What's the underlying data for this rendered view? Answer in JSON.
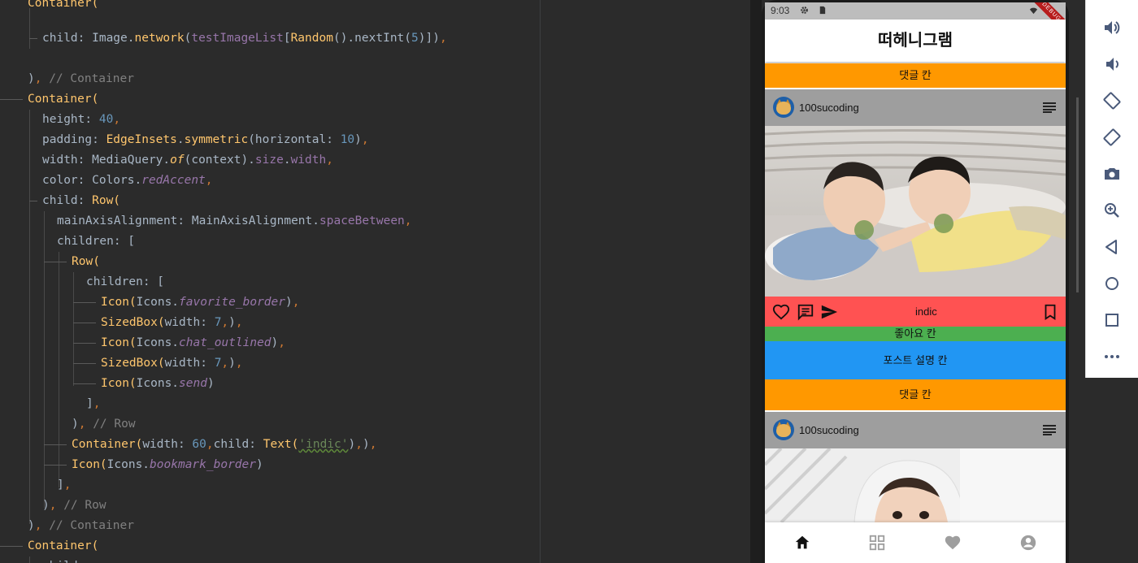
{
  "editor": {
    "lines": [
      {
        "indent": 34,
        "parts": [
          {
            "t": "Container(",
            "c": "c-cls"
          }
        ]
      },
      {
        "indent": 52,
        "parts": [
          {
            "t": "child: ",
            "c": "c-plain"
          },
          {
            "t": "Image",
            "c": "c-plain"
          },
          {
            "t": ".",
            "c": "c-plain"
          },
          {
            "t": "network",
            "c": "c-cls"
          },
          {
            "t": "(",
            "c": "c-plain"
          },
          {
            "t": "testImageList",
            "c": "c-fld"
          },
          {
            "t": "[",
            "c": "c-plain"
          },
          {
            "t": "Random",
            "c": "c-cls"
          },
          {
            "t": "().",
            "c": "c-plain"
          },
          {
            "t": "nextInt",
            "c": "c-plain"
          },
          {
            "t": "(",
            "c": "c-plain"
          },
          {
            "t": "5",
            "c": "c-num"
          },
          {
            "t": ")])",
            "c": "c-plain"
          },
          {
            "t": ",",
            "c": "c-punct"
          }
        ]
      },
      {
        "indent": 34,
        "parts": [
          {
            "t": ")",
            "c": "c-plain"
          },
          {
            "t": ", ",
            "c": "c-punct"
          },
          {
            "t": "// Container",
            "c": "c-comment"
          }
        ]
      },
      {
        "indent": 34,
        "parts": [
          {
            "t": "Container(",
            "c": "c-cls"
          }
        ]
      },
      {
        "indent": 52,
        "parts": [
          {
            "t": "height: ",
            "c": "c-plain"
          },
          {
            "t": "40",
            "c": "c-num"
          },
          {
            "t": ",",
            "c": "c-punct"
          }
        ]
      },
      {
        "indent": 52,
        "parts": [
          {
            "t": "padding: ",
            "c": "c-plain"
          },
          {
            "t": "EdgeInsets",
            "c": "c-cls"
          },
          {
            "t": ".",
            "c": "c-plain"
          },
          {
            "t": "symmetric",
            "c": "c-cls"
          },
          {
            "t": "(horizontal: ",
            "c": "c-plain"
          },
          {
            "t": "10",
            "c": "c-num"
          },
          {
            "t": ")",
            "c": "c-plain"
          },
          {
            "t": ",",
            "c": "c-punct"
          }
        ]
      },
      {
        "indent": 52,
        "parts": [
          {
            "t": "width: MediaQuery.",
            "c": "c-plain"
          },
          {
            "t": "of",
            "c": "c-method"
          },
          {
            "t": "(context).",
            "c": "c-plain"
          },
          {
            "t": "size",
            "c": "c-fld"
          },
          {
            "t": ".",
            "c": "c-plain"
          },
          {
            "t": "width",
            "c": "c-fld"
          },
          {
            "t": ",",
            "c": "c-punct"
          }
        ]
      },
      {
        "indent": 52,
        "parts": [
          {
            "t": "color: Colors.",
            "c": "c-plain"
          },
          {
            "t": "redAccent",
            "c": "c-ital"
          },
          {
            "t": ",",
            "c": "c-punct"
          }
        ]
      },
      {
        "indent": 52,
        "parts": [
          {
            "t": "child: ",
            "c": "c-plain"
          },
          {
            "t": "Row(",
            "c": "c-cls"
          }
        ]
      },
      {
        "indent": 70,
        "parts": [
          {
            "t": "mainAxisAlignment: MainAxisAlignment.",
            "c": "c-plain"
          },
          {
            "t": "spaceBetween",
            "c": "c-fld"
          },
          {
            "t": ",",
            "c": "c-punct"
          }
        ]
      },
      {
        "indent": 70,
        "parts": [
          {
            "t": "children: [",
            "c": "c-plain"
          }
        ]
      },
      {
        "indent": 88,
        "parts": [
          {
            "t": "Row(",
            "c": "c-cls"
          }
        ]
      },
      {
        "indent": 106,
        "parts": [
          {
            "t": "children: [",
            "c": "c-plain"
          }
        ]
      },
      {
        "indent": 124,
        "parts": [
          {
            "t": "Icon(",
            "c": "c-cls"
          },
          {
            "t": "Icons.",
            "c": "c-plain"
          },
          {
            "t": "favorite_border",
            "c": "c-ital"
          },
          {
            "t": ")",
            "c": "c-plain"
          },
          {
            "t": ",",
            "c": "c-punct"
          }
        ]
      },
      {
        "indent": 124,
        "parts": [
          {
            "t": "SizedBox(",
            "c": "c-cls"
          },
          {
            "t": "width: ",
            "c": "c-plain"
          },
          {
            "t": "7",
            "c": "c-num"
          },
          {
            "t": ",",
            "c": "c-punct"
          },
          {
            "t": ")",
            "c": "c-plain"
          },
          {
            "t": ",",
            "c": "c-punct"
          }
        ]
      },
      {
        "indent": 124,
        "parts": [
          {
            "t": "Icon(",
            "c": "c-cls"
          },
          {
            "t": "Icons.",
            "c": "c-plain"
          },
          {
            "t": "chat_outlined",
            "c": "c-ital"
          },
          {
            "t": ")",
            "c": "c-plain"
          },
          {
            "t": ",",
            "c": "c-punct"
          }
        ]
      },
      {
        "indent": 124,
        "parts": [
          {
            "t": "SizedBox(",
            "c": "c-cls"
          },
          {
            "t": "width: ",
            "c": "c-plain"
          },
          {
            "t": "7",
            "c": "c-num"
          },
          {
            "t": ",",
            "c": "c-punct"
          },
          {
            "t": ")",
            "c": "c-plain"
          },
          {
            "t": ",",
            "c": "c-punct"
          }
        ]
      },
      {
        "indent": 124,
        "parts": [
          {
            "t": "Icon(",
            "c": "c-cls"
          },
          {
            "t": "Icons.",
            "c": "c-plain"
          },
          {
            "t": "send",
            "c": "c-ital"
          },
          {
            "t": ")",
            "c": "c-plain"
          }
        ]
      },
      {
        "indent": 106,
        "parts": [
          {
            "t": "]",
            "c": "c-plain"
          },
          {
            "t": ",",
            "c": "c-punct"
          }
        ]
      },
      {
        "indent": 88,
        "parts": [
          {
            "t": ")",
            "c": "c-plain"
          },
          {
            "t": ", ",
            "c": "c-punct"
          },
          {
            "t": "// Row",
            "c": "c-comment"
          }
        ]
      },
      {
        "indent": 88,
        "parts": [
          {
            "t": "Container(",
            "c": "c-cls"
          },
          {
            "t": "width: ",
            "c": "c-plain"
          },
          {
            "t": "60",
            "c": "c-num"
          },
          {
            "t": ",",
            "c": "c-punct"
          },
          {
            "t": "child: ",
            "c": "c-plain"
          },
          {
            "t": "Text(",
            "c": "c-cls"
          },
          {
            "t": "'indic'",
            "c": "c-str"
          },
          {
            "t": ")",
            "c": "c-plain"
          },
          {
            "t": ",",
            "c": "c-punct"
          },
          {
            "t": ")",
            "c": "c-plain"
          },
          {
            "t": ",",
            "c": "c-punct"
          }
        ]
      },
      {
        "indent": 88,
        "parts": [
          {
            "t": "Icon(",
            "c": "c-cls"
          },
          {
            "t": "Icons.",
            "c": "c-plain"
          },
          {
            "t": "bookmark_border",
            "c": "c-ital"
          },
          {
            "t": ")",
            "c": "c-plain"
          }
        ]
      },
      {
        "indent": 70,
        "parts": [
          {
            "t": "]",
            "c": "c-plain"
          },
          {
            "t": ",",
            "c": "c-punct"
          }
        ]
      },
      {
        "indent": 52,
        "parts": [
          {
            "t": ")",
            "c": "c-plain"
          },
          {
            "t": ", ",
            "c": "c-punct"
          },
          {
            "t": "// Row",
            "c": "c-comment"
          }
        ]
      },
      {
        "indent": 34,
        "parts": [
          {
            "t": ")",
            "c": "c-plain"
          },
          {
            "t": ", ",
            "c": "c-punct"
          },
          {
            "t": "// Container",
            "c": "c-comment"
          }
        ]
      },
      {
        "indent": 34,
        "parts": [
          {
            "t": "Container(",
            "c": "c-cls"
          }
        ]
      },
      {
        "indent": 52,
        "parts": [
          {
            "t": "child: ",
            "c": "c-plain"
          }
        ]
      }
    ]
  },
  "phone": {
    "status": {
      "time": "9:03",
      "debug": "DEBUG"
    },
    "appbar_title": "떠헤니그램",
    "comment_strip": "댓글 칸",
    "like_strip": "좋아요 칸",
    "description_strip": "포스트 설명 칸",
    "posts": [
      {
        "username": "100sucoding"
      },
      {
        "username": "100sucoding"
      }
    ],
    "action_text": "indic",
    "bottom_nav": [
      "home-icon",
      "grid-icon",
      "heart-icon",
      "account-icon"
    ]
  },
  "toolbar": {
    "buttons": [
      "volume-up-icon",
      "volume-down-icon",
      "rotate-left-icon",
      "rotate-right-icon",
      "camera-icon",
      "zoom-icon",
      "back-icon",
      "home-circle-icon",
      "overview-icon",
      "more-icon"
    ]
  },
  "colors": {
    "editor_bg": "#2b2b2b",
    "orange": "#ff9800",
    "green": "#4caf50",
    "blue": "#2196f3",
    "red_accent": "#ff5252",
    "grey": "#9e9e9e"
  }
}
